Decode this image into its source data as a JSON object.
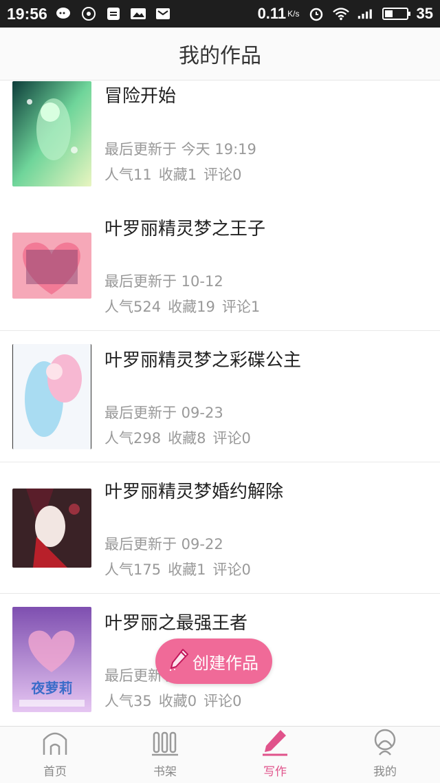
{
  "status_bar": {
    "time": "19:56",
    "speed": "0.11",
    "speed_unit": "K/s",
    "battery": "35"
  },
  "header": {
    "title": "我的作品"
  },
  "works": [
    {
      "title": "冒险开始",
      "updated": "最后更新于 今天 19:19",
      "popularity": "人气11",
      "favorites": "收藏1",
      "comments": "评论0"
    },
    {
      "title": "叶罗丽精灵梦之王子",
      "updated": "最后更新于 10-12",
      "popularity": "人气524",
      "favorites": "收藏19",
      "comments": "评论1"
    },
    {
      "title": "叶罗丽精灵梦之彩碟公主",
      "updated": "最后更新于 09-23",
      "popularity": "人气298",
      "favorites": "收藏8",
      "comments": "评论0"
    },
    {
      "title": "叶罗丽精灵梦婚约解除",
      "updated": "最后更新于 09-22",
      "popularity": "人气175",
      "favorites": "收藏1",
      "comments": "评论0"
    },
    {
      "title": "叶罗丽之最强王者",
      "updated": "最后更新于 09-21",
      "popularity": "人气35",
      "favorites": "收藏0",
      "comments": "评论0",
      "cover_text": "夜萝莉"
    }
  ],
  "fab": {
    "label": "创建作品",
    "icon": "pencil-icon"
  },
  "tabs": [
    {
      "label": "首页",
      "icon": "home-icon"
    },
    {
      "label": "书架",
      "icon": "bookshelf-icon"
    },
    {
      "label": "写作",
      "icon": "pencil-icon",
      "active": true
    },
    {
      "label": "我的",
      "icon": "user-icon"
    }
  ],
  "colors": {
    "accent": "#f06a98",
    "active_tab": "#e0538b"
  }
}
